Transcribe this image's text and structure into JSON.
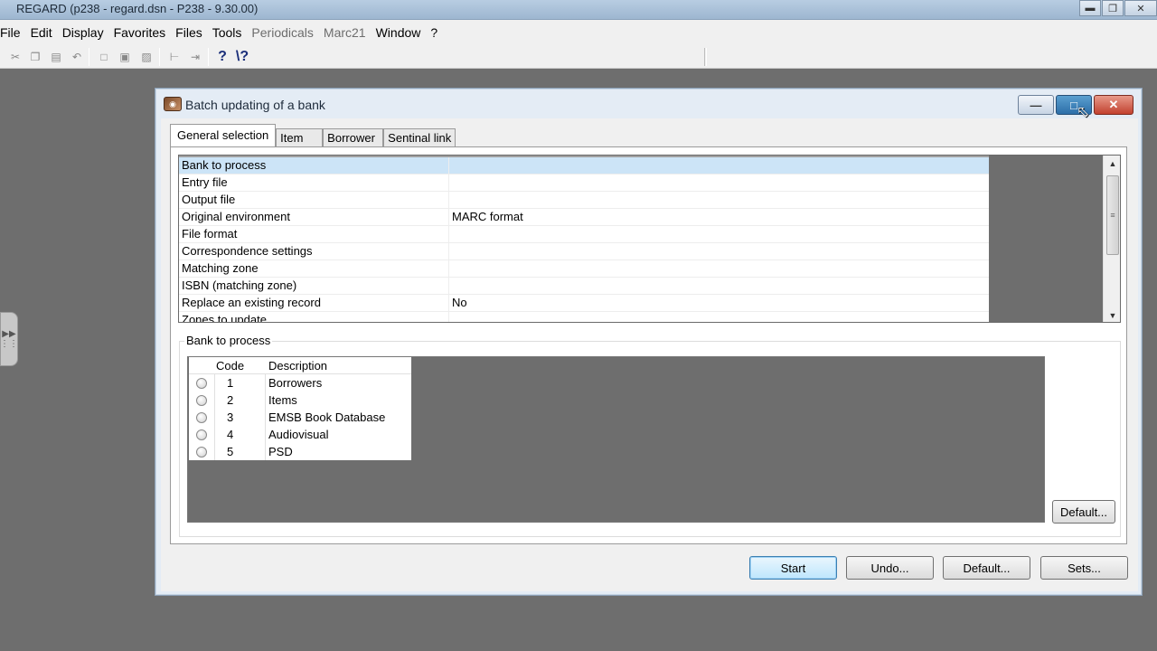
{
  "app": {
    "title": "REGARD (p238 - regard.dsn - P238 - 9.30.00)"
  },
  "menu": [
    {
      "label": "File",
      "enabled": true
    },
    {
      "label": "Edit",
      "enabled": true
    },
    {
      "label": "Display",
      "enabled": true
    },
    {
      "label": "Favorites",
      "enabled": true
    },
    {
      "label": "Files",
      "enabled": true
    },
    {
      "label": "Tools",
      "enabled": true
    },
    {
      "label": "Periodicals",
      "enabled": false
    },
    {
      "label": "Marc21",
      "enabled": false
    },
    {
      "label": "Window",
      "enabled": true
    },
    {
      "label": "?",
      "enabled": true
    }
  ],
  "toolbar": {
    "icons": [
      "cut-icon",
      "copy-icon",
      "paste-icon",
      "undo-icon",
      "select-icon",
      "book-icon",
      "clipboard-icon",
      "tree-icon",
      "indent-icon",
      "help-icon",
      "context-help-icon"
    ],
    "help_glyph": "?",
    "context_help_glyph": "\\?"
  },
  "dialog": {
    "title": "Batch updating of a bank",
    "tabs": [
      "General selection",
      "Item",
      "Borrower",
      "Sentinal link"
    ],
    "active_tab": "General selection",
    "properties": [
      {
        "key": "Bank to process",
        "value": ""
      },
      {
        "key": "Entry file",
        "value": ""
      },
      {
        "key": "Output file",
        "value": ""
      },
      {
        "key": "Original environment",
        "value": "MARC format"
      },
      {
        "key": "File format",
        "value": ""
      },
      {
        "key": "Correspondence settings",
        "value": ""
      },
      {
        "key": "Matching zone",
        "value": ""
      },
      {
        "key": "ISBN (matching zone)",
        "value": ""
      },
      {
        "key": "Replace an existing record",
        "value": "No"
      },
      {
        "key": "Zones to update",
        "value": ""
      }
    ],
    "group": {
      "label": "Bank to process",
      "columns": [
        "Code",
        "Description"
      ],
      "rows": [
        {
          "code": "1",
          "description": "Borrowers"
        },
        {
          "code": "2",
          "description": "Items"
        },
        {
          "code": "3",
          "description": "EMSB Book Database"
        },
        {
          "code": "4",
          "description": "Audiovisual"
        },
        {
          "code": "5",
          "description": "PSD"
        }
      ],
      "default_button": "Default..."
    },
    "buttons": {
      "start": "Start",
      "undo": "Undo...",
      "default": "Default...",
      "sets": "Sets..."
    }
  }
}
